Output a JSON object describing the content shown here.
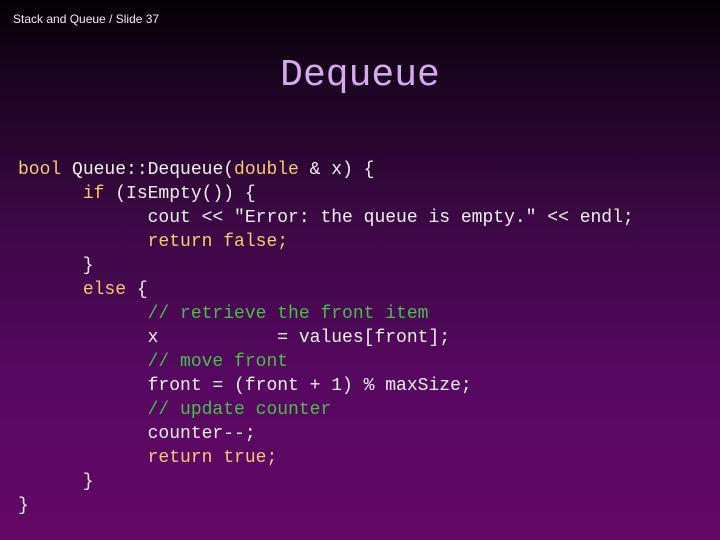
{
  "header": {
    "breadcrumb": "Stack and Queue / Slide 37"
  },
  "slide": {
    "title": "Dequeue"
  },
  "colors": {
    "keyword": "#f8c878",
    "comment": "#4cbc4c",
    "text": "#f0f0f0",
    "title": "#d8a8ee"
  },
  "code": {
    "lines": [
      [
        {
          "t": "bool",
          "k": "kw"
        },
        {
          "t": " Queue::Dequeue(",
          "k": ""
        },
        {
          "t": "double",
          "k": "kw"
        },
        {
          "t": " & x) {",
          "k": ""
        }
      ],
      [
        {
          "t": "      ",
          "k": ""
        },
        {
          "t": "if",
          "k": "kw"
        },
        {
          "t": " (IsEmpty()) {",
          "k": ""
        }
      ],
      [
        {
          "t": "            cout << \"Error: the queue is empty.\" << endl;",
          "k": ""
        }
      ],
      [
        {
          "t": "            ",
          "k": ""
        },
        {
          "t": "return false;",
          "k": "kw"
        }
      ],
      [
        {
          "t": "      }",
          "k": ""
        }
      ],
      [
        {
          "t": "      ",
          "k": ""
        },
        {
          "t": "else",
          "k": "kw"
        },
        {
          "t": " {",
          "k": ""
        }
      ],
      [
        {
          "t": "            ",
          "k": ""
        },
        {
          "t": "// retrieve the front item",
          "k": "cm"
        }
      ],
      [
        {
          "t": "            x           = values[front];",
          "k": ""
        }
      ],
      [
        {
          "t": "            ",
          "k": ""
        },
        {
          "t": "// move front",
          "k": "cm"
        }
      ],
      [
        {
          "t": "            front = (front + 1) % maxSize;",
          "k": ""
        }
      ],
      [
        {
          "t": "            ",
          "k": ""
        },
        {
          "t": "// update counter",
          "k": "cm"
        }
      ],
      [
        {
          "t": "            counter--;",
          "k": ""
        }
      ],
      [
        {
          "t": "            ",
          "k": ""
        },
        {
          "t": "return true;",
          "k": "kw"
        }
      ],
      [
        {
          "t": "      }",
          "k": ""
        }
      ],
      [
        {
          "t": "}",
          "k": ""
        }
      ]
    ]
  }
}
